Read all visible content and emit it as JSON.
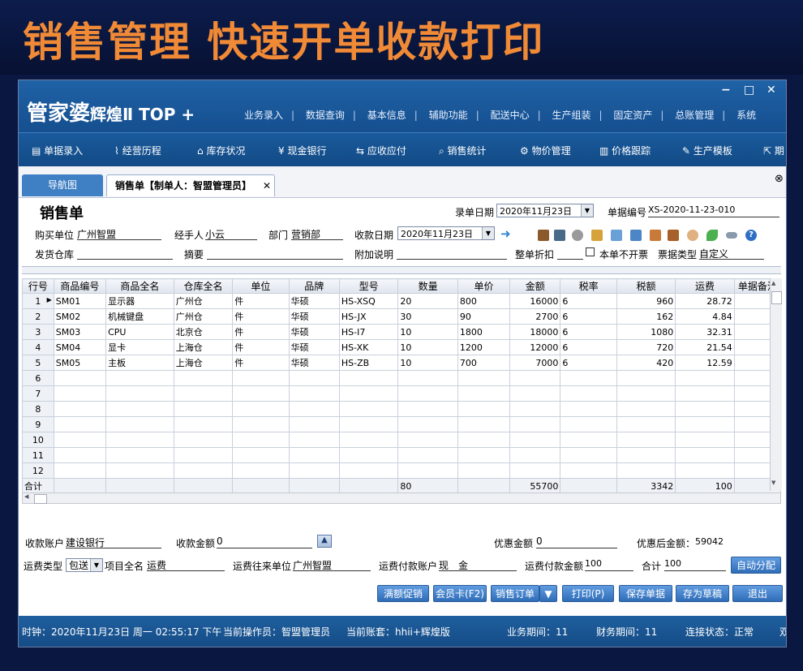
{
  "banner": {
    "title": "销售管理 快速开单收款打印"
  },
  "app": {
    "logo": "管家婆",
    "logo_sub": "辉煌Ⅱ TOP +",
    "window_controls": [
      "−",
      "□",
      "✕"
    ],
    "top_menu": [
      "业务录入",
      "数据查询",
      "基本信息",
      "辅助功能",
      "配送中心",
      "生产组装",
      "固定资产",
      "总账管理",
      "系统"
    ]
  },
  "toolbar": [
    {
      "icon": "form-icon",
      "label": "单据录入"
    },
    {
      "icon": "chart-icon",
      "label": "经营历程"
    },
    {
      "icon": "home-icon",
      "label": "库存状况"
    },
    {
      "icon": "yen-icon",
      "label": "现金银行"
    },
    {
      "icon": "exchange-icon",
      "label": "应收应付"
    },
    {
      "icon": "search-icon",
      "label": "销售统计"
    },
    {
      "icon": "gear-icon",
      "label": "物价管理"
    },
    {
      "icon": "bar-chart-icon",
      "label": "价格跟踪"
    },
    {
      "icon": "wrench-icon",
      "label": "生产模板"
    },
    {
      "icon": "export-icon",
      "label": "期"
    }
  ],
  "tabs": {
    "nav": "导航图",
    "current": "销售单【制单人：智盟管理员】",
    "close": "✕",
    "close_all": "⊗"
  },
  "form": {
    "title": "销售单",
    "entry_date_label": "录单日期",
    "entry_date": "2020年11月23日",
    "doc_no_label": "单据编号",
    "doc_no": "XS-2020-11-23-010",
    "buyer_label": "购买单位",
    "buyer": "广州智盟",
    "handler_label": "经手人",
    "handler": "小云",
    "dept_label": "部门",
    "dept": "营销部",
    "collect_date_label": "收款日期",
    "collect_date": "2020年11月23日",
    "ship_wh_label": "发货仓库",
    "ship_wh": "",
    "summary_label": "摘要",
    "summary": "",
    "note_label": "附加说明",
    "note": "",
    "discount_label": "整单折扣",
    "discount": "",
    "no_invoice_label": "本单不开票",
    "invoice_type_label": "票据类型",
    "invoice_type": "自定义"
  },
  "grid": {
    "headers": [
      "行号",
      "商品编号",
      "商品全名",
      "仓库全名",
      "单位",
      "品牌",
      "型号",
      "数量",
      "单价",
      "金额",
      "税率",
      "税额",
      "运费",
      "单据备注"
    ],
    "rows": [
      [
        "1",
        "SM01",
        "显示器",
        "广州仓",
        "件",
        "华硕",
        "HS-XSQ",
        "20",
        "800",
        "16000",
        "6",
        "960",
        "28.72",
        ""
      ],
      [
        "2",
        "SM02",
        "机械键盘",
        "广州仓",
        "件",
        "华硕",
        "HS-JX",
        "30",
        "90",
        "2700",
        "6",
        "162",
        "4.84",
        ""
      ],
      [
        "3",
        "SM03",
        "CPU",
        "北京仓",
        "件",
        "华硕",
        "HS-I7",
        "10",
        "1800",
        "18000",
        "6",
        "1080",
        "32.31",
        ""
      ],
      [
        "4",
        "SM04",
        "显卡",
        "上海仓",
        "件",
        "华硕",
        "HS-XK",
        "10",
        "1200",
        "12000",
        "6",
        "720",
        "21.54",
        ""
      ],
      [
        "5",
        "SM05",
        "主板",
        "上海仓",
        "件",
        "华硕",
        "HS-ZB",
        "10",
        "700",
        "7000",
        "6",
        "420",
        "12.59",
        ""
      ],
      [
        "6",
        "",
        "",
        "",
        "",
        "",
        "",
        "",
        "",
        "",
        "",
        "",
        "",
        ""
      ],
      [
        "7",
        "",
        "",
        "",
        "",
        "",
        "",
        "",
        "",
        "",
        "",
        "",
        "",
        ""
      ],
      [
        "8",
        "",
        "",
        "",
        "",
        "",
        "",
        "",
        "",
        "",
        "",
        "",
        "",
        ""
      ],
      [
        "9",
        "",
        "",
        "",
        "",
        "",
        "",
        "",
        "",
        "",
        "",
        "",
        "",
        ""
      ],
      [
        "10",
        "",
        "",
        "",
        "",
        "",
        "",
        "",
        "",
        "",
        "",
        "",
        "",
        ""
      ],
      [
        "11",
        "",
        "",
        "",
        "",
        "",
        "",
        "",
        "",
        "",
        "",
        "",
        "",
        ""
      ],
      [
        "12",
        "",
        "",
        "",
        "",
        "",
        "",
        "",
        "",
        "",
        "",
        "",
        "",
        ""
      ]
    ],
    "total": [
      "合计",
      "",
      "",
      "",
      "",
      "",
      "",
      "80",
      "",
      "55700",
      "",
      "3342",
      "100",
      ""
    ]
  },
  "payment": {
    "account_label": "收款账户",
    "account": "建设银行",
    "amount_label": "收款金额",
    "amount": "0",
    "discount_amt_label": "优惠金额",
    "discount_amt": "0",
    "after_discount_label": "优惠后金额：",
    "after_discount": "59042",
    "freight_type_label": "运费类型",
    "freight_type": "包送",
    "item_name_label": "项目全名",
    "item_name": "运费",
    "freight_unit_label": "运费往来单位",
    "freight_unit": "广州智盟",
    "freight_account_label": "运费付款账户",
    "freight_account": "现　金",
    "freight_pay_label": "运费付款金额",
    "freight_pay": "100",
    "total_label": "合计",
    "total": "100",
    "auto_split": "自动分配"
  },
  "buttons": [
    "满额促销",
    "会员卡(F2)",
    "销售订单",
    "打印(P)",
    "保存单据",
    "存为草稿",
    "退出"
  ],
  "status": {
    "clock": "时钟：2020年11月23日 周一 02:55:17 下午",
    "operator": "当前操作员：智盟管理员",
    "account_set": "当前账套：hhii+辉煌版",
    "biz_period": "业务期间：11",
    "fin_period": "财务期间：11",
    "conn": "连接状态：正常",
    "extra": "双"
  },
  "colors": {
    "banner_text": "#f08a36",
    "titlebar": "#1f62a6",
    "accent": "#3f7fc4"
  }
}
